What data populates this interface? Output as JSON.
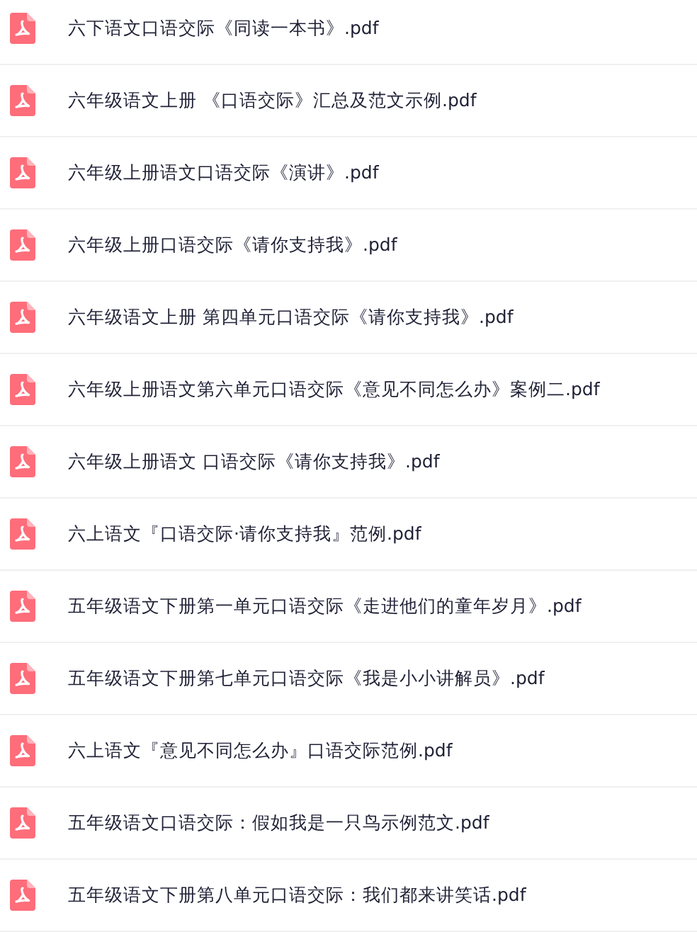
{
  "files": [
    {
      "name": "六下语文口语交际《同读一本书》.pdf"
    },
    {
      "name": "六年级语文上册 《口语交际》汇总及范文示例.pdf"
    },
    {
      "name": "六年级上册语文口语交际《演讲》.pdf"
    },
    {
      "name": "六年级上册口语交际《请你支持我》.pdf"
    },
    {
      "name": "六年级语文上册 第四单元口语交际《请你支持我》.pdf"
    },
    {
      "name": "六年级上册语文第六单元口语交际《意见不同怎么办》案例二.pdf"
    },
    {
      "name": "六年级上册语文 口语交际《请你支持我》.pdf"
    },
    {
      "name": "六上语文『口语交际·请你支持我』范例.pdf"
    },
    {
      "name": "五年级语文下册第一单元口语交际《走进他们的童年岁月》.pdf"
    },
    {
      "name": "五年级语文下册第七单元口语交际《我是小小讲解员》.pdf"
    },
    {
      "name": "六上语文『意见不同怎么办』口语交际范例.pdf"
    },
    {
      "name": "五年级语文口语交际：假如我是一只鸟示例范文.pdf"
    },
    {
      "name": "五年级语文下册第八单元口语交际：我们都来讲笑话.pdf"
    }
  ]
}
